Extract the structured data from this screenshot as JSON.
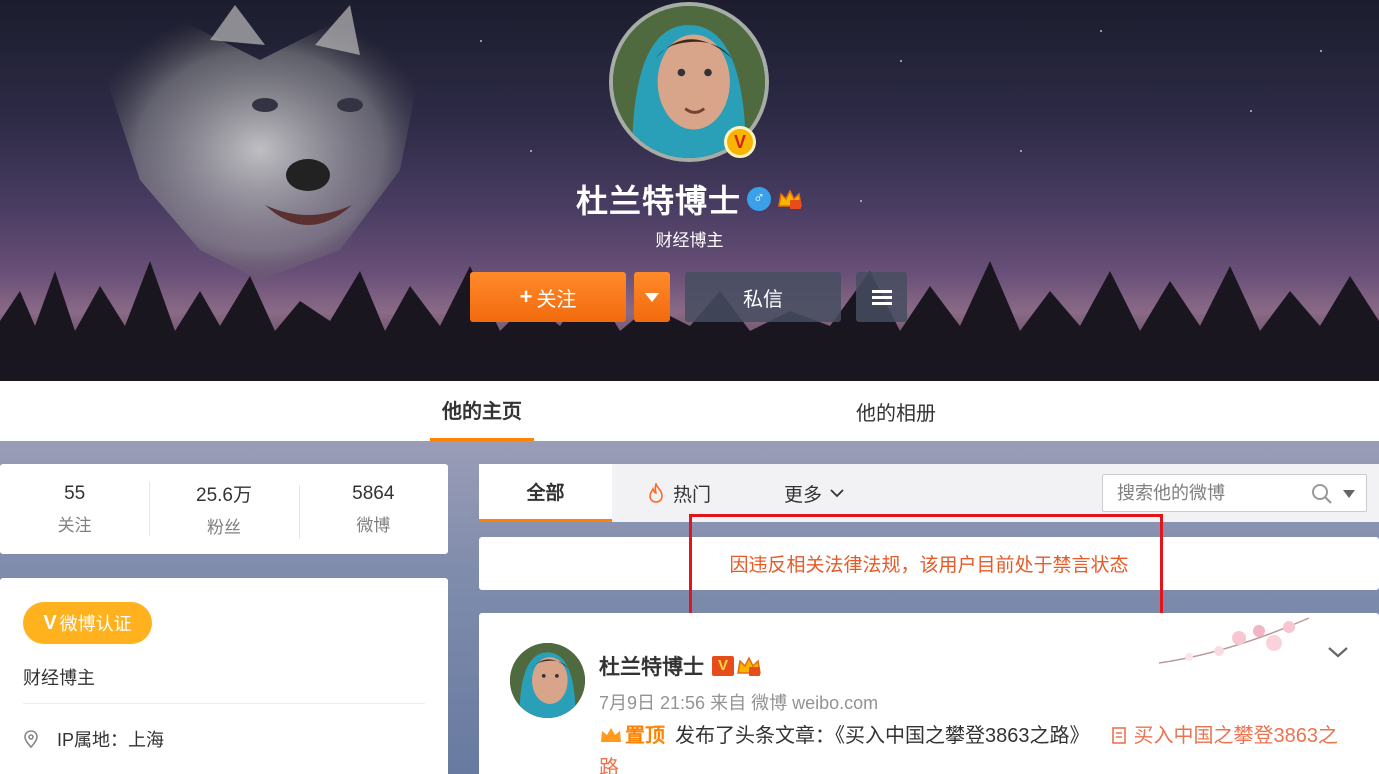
{
  "profile": {
    "name": "杜兰特博士",
    "description": "财经博主",
    "gender_icon": "♂",
    "verified_mark": "V"
  },
  "actions": {
    "follow_label": "关注",
    "follow_plus": "+",
    "message_label": "私信"
  },
  "nav": {
    "home": "他的主页",
    "album": "他的相册"
  },
  "stats": [
    {
      "value": "55",
      "label": "关注"
    },
    {
      "value": "25.6万",
      "label": "粉丝"
    },
    {
      "value": "5864",
      "label": "微博"
    }
  ],
  "info": {
    "verify_badge": "微博认证",
    "verify_v": "V",
    "description": "财经博主",
    "ip_location": "IP属地：上海"
  },
  "filter": {
    "all": "全部",
    "hot": "热门",
    "more": "更多",
    "search_placeholder": "搜索他的微博"
  },
  "notice": "因违反相关法律法规，该用户目前处于禁言状态",
  "post": {
    "author": "杜兰特博士",
    "verified_mark": "V",
    "meta": "7月9日 21:56 来自 微博 weibo.com",
    "pinned_label": "置顶",
    "body_text": "发布了头条文章：《买入中国之攀登3863之路》",
    "article_link": "买入中国之攀登3863之路"
  },
  "colors": {
    "accent_orange": "#ff8200",
    "notice_red": "#e85a27",
    "highlight_box": "#e3141c"
  }
}
